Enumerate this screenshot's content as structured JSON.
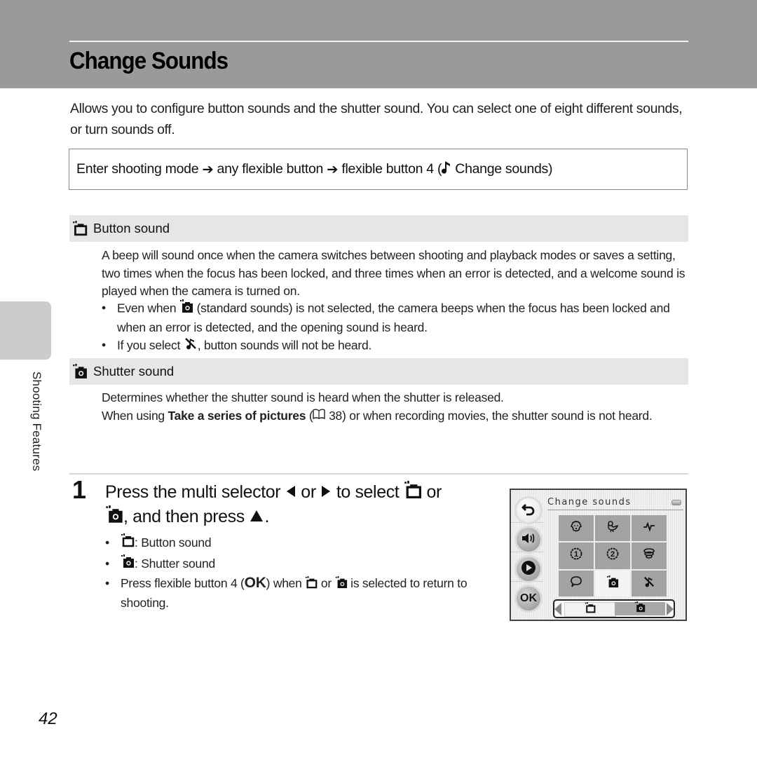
{
  "header": {
    "title": "Change Sounds"
  },
  "intro": "Allows you to configure button sounds and the shutter sound. You can select one of eight different sounds, or turn sounds off.",
  "menu_path": {
    "step1": "Enter shooting mode",
    "arrow": "➔",
    "step2": "any flexible button",
    "step3": "flexible button 4 (",
    "step3_icon": "music-note-icon",
    "step3_label": "Change sounds)"
  },
  "sections": [
    {
      "icon": "button-sound-icon",
      "heading": "Button sound",
      "body": "A beep will sound once when the camera switches between shooting and playback modes or saves a setting, two times when the focus has been locked, and three times when an error is detected, and a welcome sound is played when the camera is turned on.",
      "bullets": [
        {
          "pre": "Even when ",
          "icon": "standard-shutter-sound-icon",
          "post": " (standard sounds) is not selected, the camera beeps when the focus has been locked and when an error is detected, and the opening sound is heard."
        },
        {
          "pre": "If you select ",
          "icon": "sound-off-icon",
          "post": ", button sounds will not be heard."
        }
      ]
    },
    {
      "icon": "shutter-sound-icon",
      "heading": "Shutter sound",
      "body1": "Determines whether the shutter sound is heard when the shutter is released.",
      "body2_pre": "When using ",
      "body2_bold": "Take a series of pictures",
      "body2_ref_open": " (",
      "body2_ref_icon": "book-icon",
      "body2_ref_page": " 38)",
      "body2_post": " or when recording movies, the shutter sound is not heard."
    }
  ],
  "side_tab": {
    "label": "Shooting Features"
  },
  "step": {
    "number": "1",
    "text_a": "Press the multi selector ",
    "left_icon": "left-arrow-icon",
    "or1": " or ",
    "right_icon": "right-arrow-icon",
    "text_b": " to select ",
    "or2": " or",
    "text_c": ", and then press ",
    "up_icon": "up-arrow-icon",
    "text_d": ".",
    "bullets": [
      {
        "label": ": Button sound"
      },
      {
        "label": ": Shutter sound"
      },
      {
        "pre": "Press flexible button 4 (",
        "ok": "OK",
        "mid": ") when ",
        "or": " or ",
        "post": " is selected to return to shooting."
      }
    ]
  },
  "camera_screen": {
    "title": "Change sounds",
    "side_buttons": [
      "back",
      "volume",
      "playback",
      "OK"
    ],
    "ok_label": "OK",
    "grid": [
      {
        "icon": "dog-icon",
        "selected": false
      },
      {
        "icon": "bird-icon",
        "selected": false
      },
      {
        "icon": "pulse-icon",
        "selected": false
      },
      {
        "icon": "number-1-icon",
        "selected": false
      },
      {
        "icon": "number-2-icon",
        "selected": false
      },
      {
        "icon": "coil-icon",
        "selected": false
      },
      {
        "icon": "speech-bubble-icon",
        "selected": false
      },
      {
        "icon": "standard-shutter-sound-icon",
        "selected": true
      },
      {
        "icon": "sound-off-icon",
        "selected": false
      }
    ],
    "selector": {
      "options": [
        "button-sound",
        "shutter-sound"
      ],
      "active": "shutter-sound"
    }
  },
  "page_number": "42"
}
